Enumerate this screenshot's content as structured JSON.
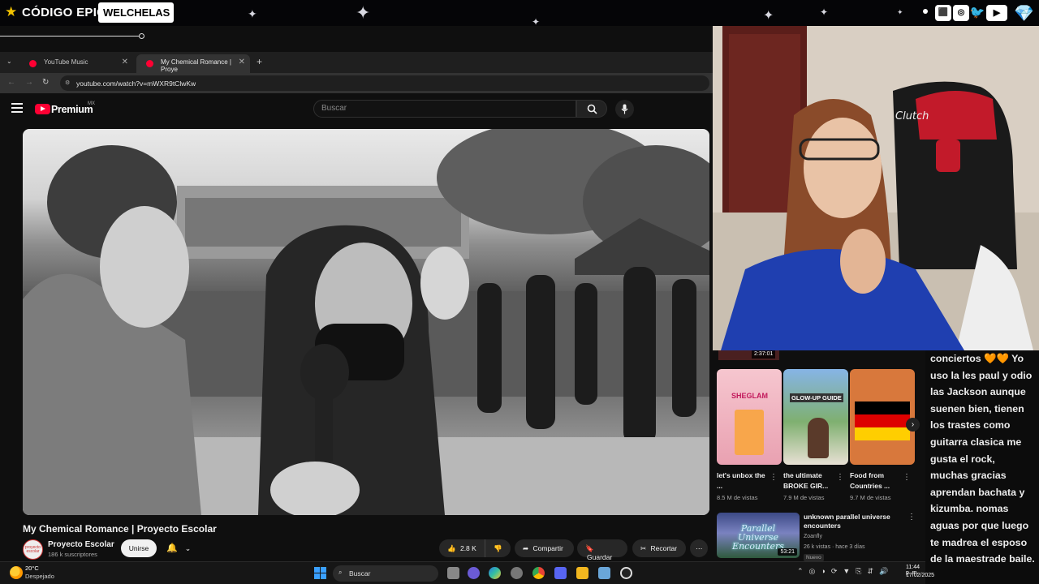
{
  "overlay": {
    "brand_prefix": "CÓDIGO EPIC",
    "channel": "WELCHELAS",
    "social_icons": [
      "twitch-icon",
      "instagram-icon",
      "twitter-icon",
      "youtube-icon"
    ],
    "accent": "#f2c200"
  },
  "browser": {
    "tabs": [
      {
        "label": "YouTube Music",
        "active": false
      },
      {
        "label": "My Chemical Romance | Proye",
        "active": true
      }
    ],
    "new_tab": "+",
    "url": "youtube.com/watch?v=mWXR9tClwKw"
  },
  "youtube": {
    "logo_text": "Premium",
    "region": "MX",
    "search_placeholder": "Buscar",
    "video_title": "My Chemical Romance | Proyecto Escolar",
    "channel": {
      "avatar_text": "proyecto escolar",
      "name": "Proyecto Escolar",
      "subscribers": "186 k suscriptores",
      "join_label": "Unirse"
    },
    "actions": {
      "likes": "2.8 K",
      "share": "Compartir",
      "save": "Guardar",
      "clip": "Recortar"
    },
    "sidebar": {
      "prev_duration": "2:37:01",
      "shorts": [
        {
          "title": "let's unbox the ...",
          "views": "8.5 M de vistas",
          "thumb_text": "SHEGLAM"
        },
        {
          "title": "the ultimate BROKE GIR...",
          "views": "7.9 M de vistas",
          "thumb_text": "GLOW-UP GUIDE"
        },
        {
          "title": "Food from Countries ...",
          "views": "9.7 M de vistas",
          "thumb_text": ""
        }
      ],
      "video": {
        "thumb_text": "Parallel Universe Encounters",
        "duration": "53:21",
        "title": "unknown parallel universe encounters",
        "channel": "Zoanfly",
        "meta": "26 k vistas · hace 3 días",
        "badge": "Nuevo"
      }
    }
  },
  "chat": {
    "text": "conciertos 🧡🧡 Yo uso la les paul y odio las Jackson aunque suenen bien, tienen los trastes como guitarra clasica me gusta el rock, muchas gracias aprendan bachata y kizumba. nomas aguas por que luego te madrea el esposo de la maestrade baile."
  },
  "taskbar": {
    "temperature": "20°C",
    "weather": "Despejado",
    "search": "Buscar",
    "time": "11:44 p. m.",
    "date": "17/02/2025"
  }
}
